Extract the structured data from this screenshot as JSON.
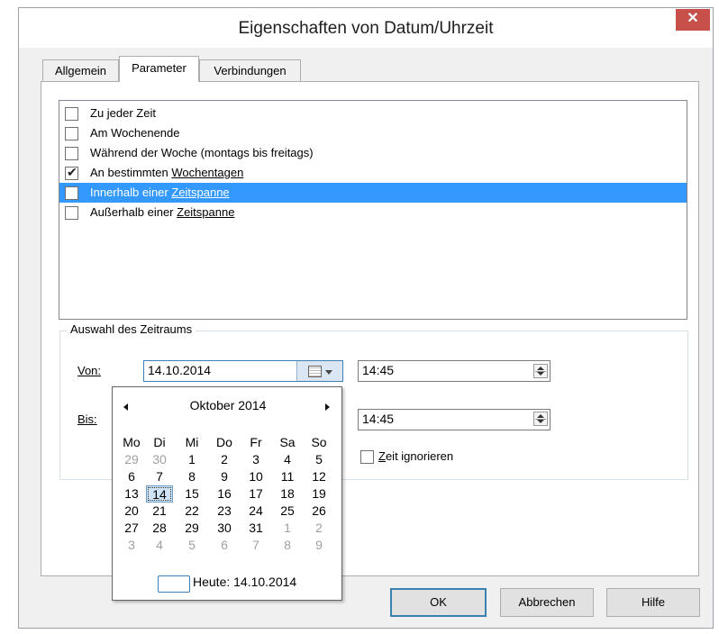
{
  "window": {
    "title": "Eigenschaften von Datum/Uhrzeit",
    "close_glyph": "✕"
  },
  "tabs": [
    {
      "label": "Allgemein",
      "active": false
    },
    {
      "label": "Parameter",
      "active": true
    },
    {
      "label": "Verbindungen",
      "active": false
    }
  ],
  "list": {
    "items": [
      {
        "pre": "Zu jeder Zeit",
        "link": "",
        "checked": false,
        "selected": false
      },
      {
        "pre": "Am Wochenende",
        "link": "",
        "checked": false,
        "selected": false
      },
      {
        "pre": "Während der Woche (montags bis freitags)",
        "link": "",
        "checked": false,
        "selected": false
      },
      {
        "pre": "An bestimmten ",
        "link": "Wochentagen",
        "checked": true,
        "selected": false
      },
      {
        "pre": "Innerhalb einer ",
        "link": "Zeitspanne",
        "checked": false,
        "selected": true
      },
      {
        "pre": "Außerhalb einer ",
        "link": "Zeitspanne",
        "checked": false,
        "selected": false
      }
    ],
    "check_glyph": "✔"
  },
  "range_group": {
    "title": "Auswahl des Zeitraums",
    "von_label": "Von:",
    "bis_label": "Bis:",
    "von_date": "14.10.2014",
    "von_time": "14:45",
    "bis_time": "14:45",
    "ignore_time_label": "Zeit ignorieren"
  },
  "calendar": {
    "month_label": "Oktober 2014",
    "weekdays": [
      "Mo",
      "Di",
      "Mi",
      "Do",
      "Fr",
      "Sa",
      "So"
    ],
    "weeks": [
      [
        {
          "d": "29",
          "g": true
        },
        {
          "d": "30",
          "g": true
        },
        {
          "d": "1"
        },
        {
          "d": "2"
        },
        {
          "d": "3"
        },
        {
          "d": "4"
        },
        {
          "d": "5"
        }
      ],
      [
        {
          "d": "6"
        },
        {
          "d": "7"
        },
        {
          "d": "8"
        },
        {
          "d": "9"
        },
        {
          "d": "10"
        },
        {
          "d": "11"
        },
        {
          "d": "12"
        }
      ],
      [
        {
          "d": "13"
        },
        {
          "d": "14",
          "cur": true
        },
        {
          "d": "15"
        },
        {
          "d": "16"
        },
        {
          "d": "17"
        },
        {
          "d": "18"
        },
        {
          "d": "19"
        }
      ],
      [
        {
          "d": "20"
        },
        {
          "d": "21"
        },
        {
          "d": "22"
        },
        {
          "d": "23"
        },
        {
          "d": "24"
        },
        {
          "d": "25"
        },
        {
          "d": "26"
        }
      ],
      [
        {
          "d": "27"
        },
        {
          "d": "28"
        },
        {
          "d": "29"
        },
        {
          "d": "30"
        },
        {
          "d": "31"
        },
        {
          "d": "1",
          "g": true
        },
        {
          "d": "2",
          "g": true
        }
      ],
      [
        {
          "d": "3",
          "g": true
        },
        {
          "d": "4",
          "g": true
        },
        {
          "d": "5",
          "g": true
        },
        {
          "d": "6",
          "g": true
        },
        {
          "d": "7",
          "g": true
        },
        {
          "d": "8",
          "g": true
        },
        {
          "d": "9",
          "g": true
        }
      ]
    ],
    "today_label": "Heute: 14.10.2014"
  },
  "buttons": {
    "ok": "OK",
    "cancel": "Abbrechen",
    "help": "Hilfe"
  },
  "colors": {
    "selection": "#3399ff",
    "close": "#c7504a",
    "accent": "#3c7fb1"
  }
}
